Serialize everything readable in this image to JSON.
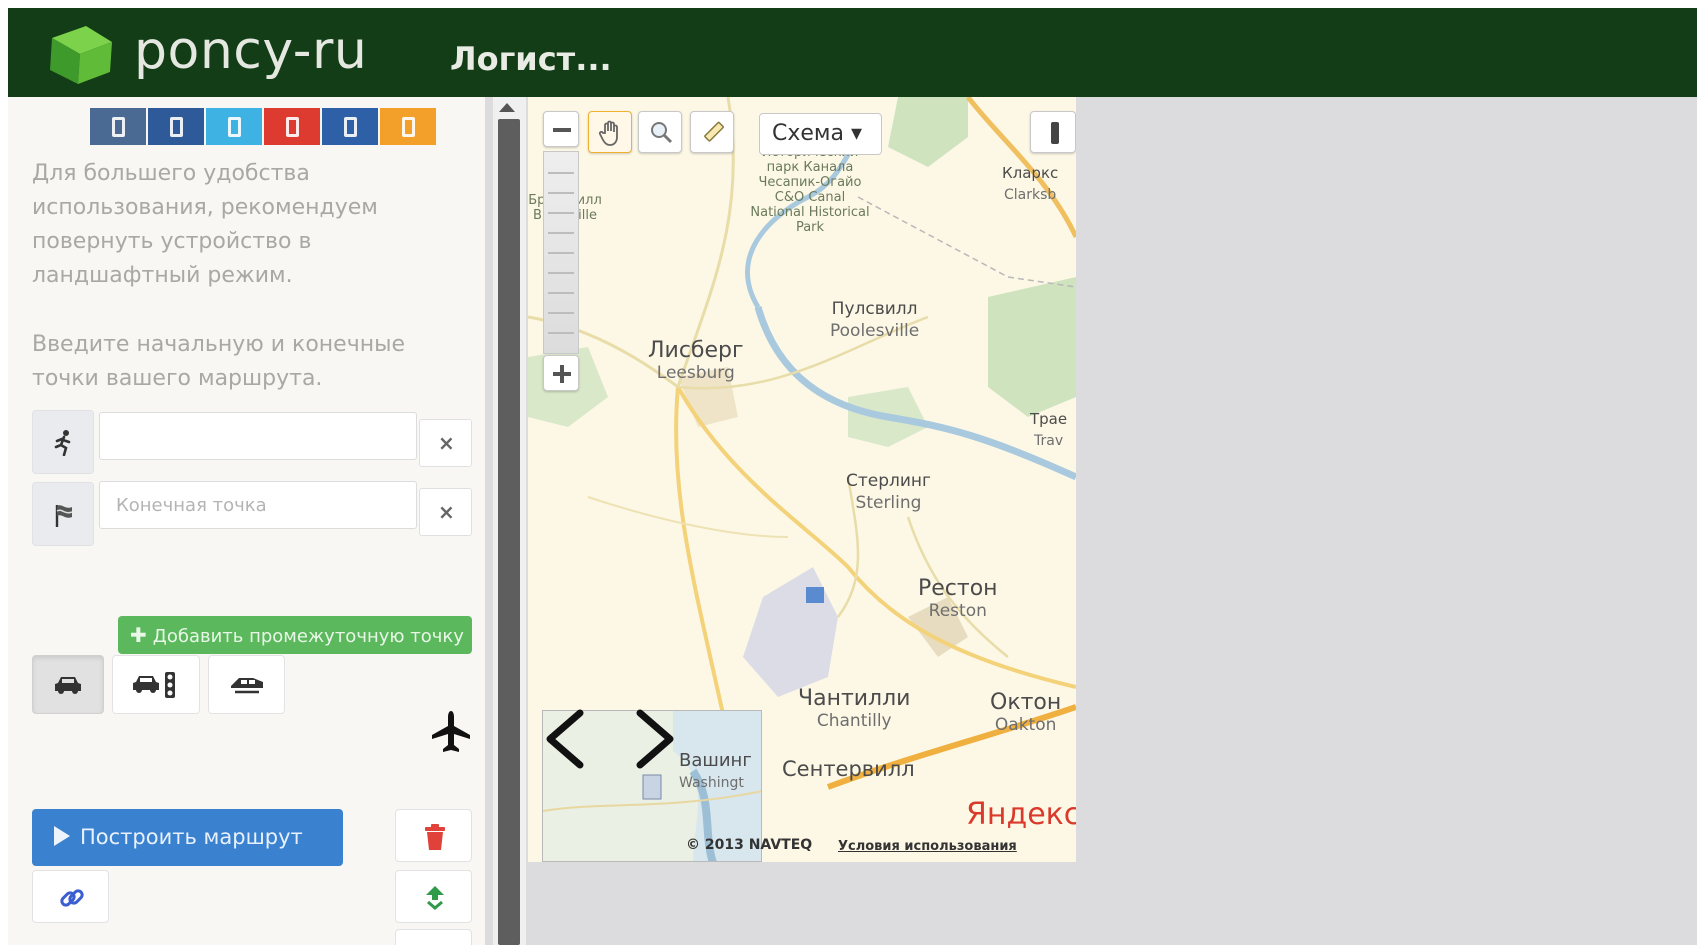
{
  "header": {
    "brand": "poncy-ru",
    "page_title": "Логист..."
  },
  "social": [
    {
      "icon": "social-icon",
      "color": "#4a6a94"
    },
    {
      "icon": "social-icon",
      "color": "#2f5a9a"
    },
    {
      "icon": "social-icon",
      "color": "#3fb2e4"
    },
    {
      "icon": "social-icon",
      "color": "#dd3b2f"
    },
    {
      "icon": "social-icon",
      "color": "#2d60a6"
    },
    {
      "icon": "social-icon",
      "color": "#f3a02a"
    }
  ],
  "panel": {
    "orientation_hint": "Для большего удобства использования, рекомендуем повернуть устройство в ландшафтный режим.",
    "route_hint": "Введите начальную и конечные точки вашего маршрута.",
    "start_value": "",
    "end_placeholder": "Конечная точка",
    "clear_label": "×",
    "add_point_label": "Добавить промежуточную точку",
    "build_route_label": "Построить маршрут"
  },
  "map": {
    "scheme_label": "Схема ▾",
    "cities": [
      {
        "ru": "Лисберг",
        "en": "Leesburg"
      },
      {
        "ru": "Пулсвилл",
        "en": "Poolesville"
      },
      {
        "ru": "Стерлинг",
        "en": "Sterling"
      },
      {
        "ru": "Рестон",
        "en": "Reston"
      },
      {
        "ru": "Чантилли",
        "en": "Chantilly"
      },
      {
        "ru": "Октон",
        "en": "Oakton"
      },
      {
        "ru": "Сентервилл",
        "en": ""
      },
      {
        "ru": "Кларкс",
        "en": "Clarksb"
      },
      {
        "ru": "Трае",
        "en": "Trav"
      },
      {
        "ru": "Вашинг",
        "en": "Washingt"
      }
    ],
    "park_label": "Исторический парк Канала Чесапик-Огайо C&O Canal National Historical Park",
    "west_label": "Брансвилл Brunsville",
    "yandex_logo": "Яндекс",
    "copyright": "© 2013 NAVTEQ",
    "terms": "Условия использования"
  },
  "colors": {
    "header_bg": "#123d16",
    "panel_bg": "#f8f7f4",
    "green_btn": "#5cb85c",
    "blue_btn": "#3a82d0",
    "trash_red": "#e0423a",
    "swap_green": "#2e9a4a",
    "link_blue": "#3b5fd1"
  }
}
